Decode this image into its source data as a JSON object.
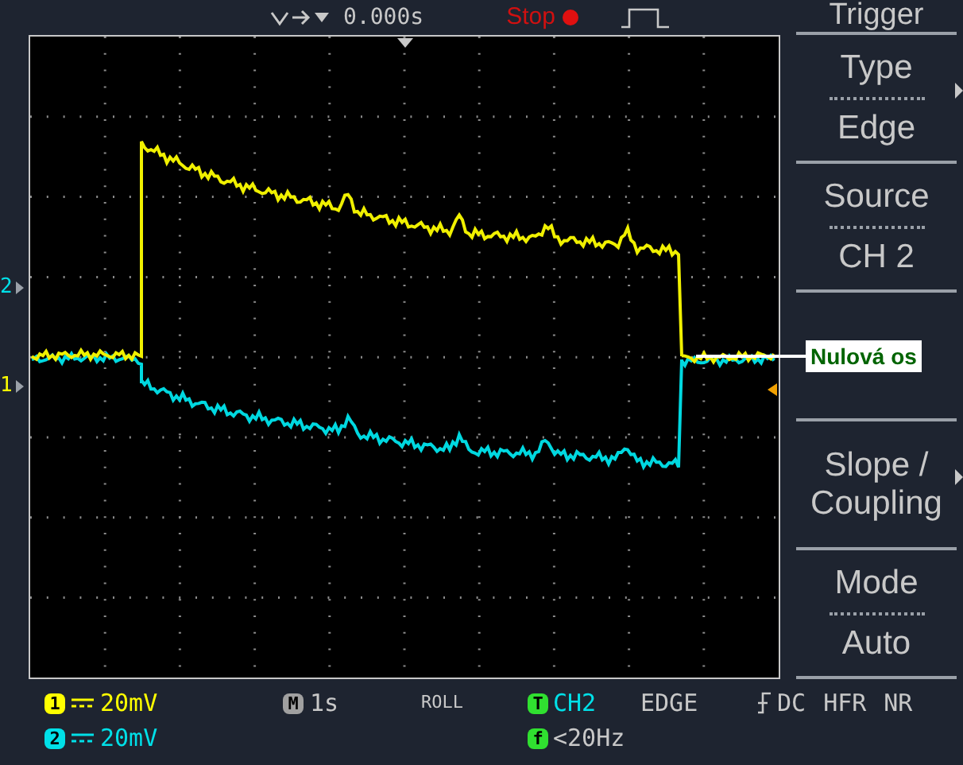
{
  "top_bar": {
    "time_offset": "0.000s",
    "run_state": "Stop"
  },
  "channel_markers": [
    {
      "label": "2",
      "color": "#00e0e8"
    },
    {
      "label": "1",
      "color": "#ffff00"
    }
  ],
  "menu": {
    "title": "Trigger",
    "items": [
      {
        "kind": "pair",
        "label": "Type",
        "value": "Edge",
        "has_submenu": true
      },
      {
        "kind": "pair",
        "label": "Source",
        "value": "CH 2",
        "has_submenu": false
      },
      {
        "kind": "blank"
      },
      {
        "kind": "single",
        "label": "Slope /\nCoupling",
        "has_submenu": true
      },
      {
        "kind": "pair",
        "label": "Mode",
        "value": "Auto",
        "has_submenu": false
      }
    ]
  },
  "annotation": {
    "text": "Nulová os"
  },
  "status_bar": {
    "channels": [
      {
        "badge": "1",
        "scale": "20mV",
        "color": "#ffff00"
      },
      {
        "badge": "2",
        "scale": "20mV",
        "color": "#00e0e8"
      }
    ],
    "timebase": {
      "badge": "M",
      "value": "1s"
    },
    "mode": "ROLL",
    "trigger": {
      "badge": "T",
      "source": "CH2",
      "type": "EDGE",
      "coupling": "DC",
      "hf_reject": "HFR",
      "noise_reject": "NR"
    },
    "frequency": {
      "badge": "f",
      "value": "<20Hz"
    }
  }
}
